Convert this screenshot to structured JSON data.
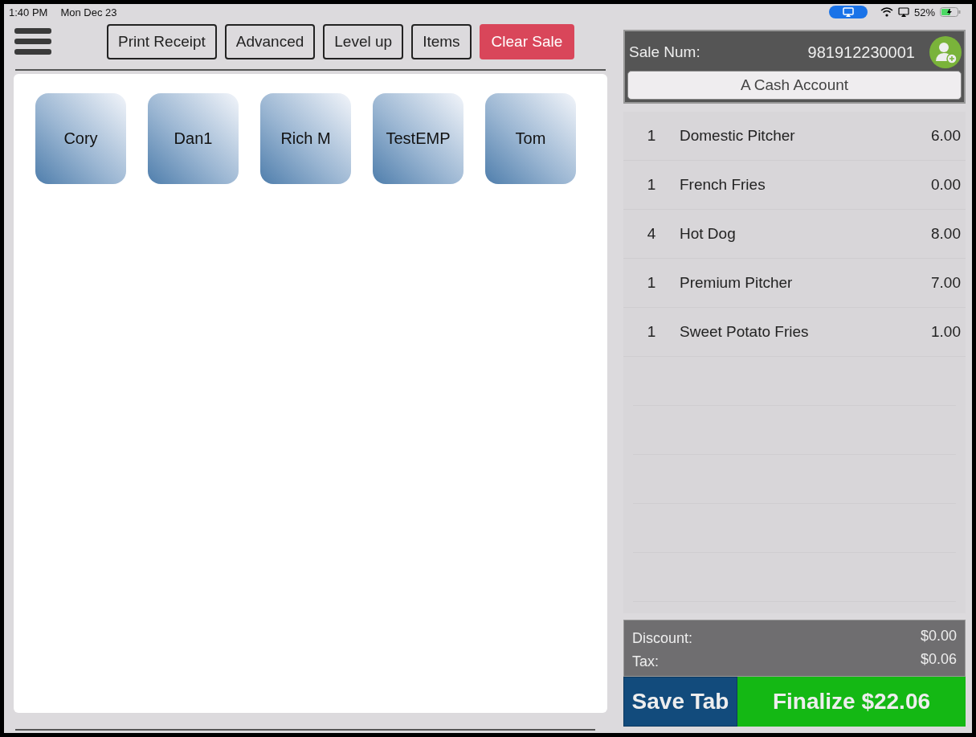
{
  "status_bar": {
    "time": "1:40 PM",
    "date": "Mon Dec 23",
    "battery": "52%"
  },
  "toolbar": {
    "buttons": [
      {
        "label": "Print Receipt",
        "kind": "outline"
      },
      {
        "label": "Advanced",
        "kind": "outline"
      },
      {
        "label": "Level up",
        "kind": "outline"
      },
      {
        "label": "Items",
        "kind": "outline"
      },
      {
        "label": "Clear Sale",
        "kind": "danger"
      }
    ]
  },
  "employees": [
    "Cory",
    "Dan1",
    "Rich M",
    "TestEMP",
    "Tom"
  ],
  "sale": {
    "label": "Sale Num:",
    "number": "981912230001",
    "account": "A Cash Account"
  },
  "line_items": [
    {
      "qty": "1",
      "name": "Domestic Pitcher",
      "price": "6.00"
    },
    {
      "qty": "1",
      "name": "French Fries",
      "price": "0.00"
    },
    {
      "qty": "4",
      "name": "Hot Dog",
      "price": "8.00"
    },
    {
      "qty": "1",
      "name": "Premium Pitcher",
      "price": "7.00"
    },
    {
      "qty": "1",
      "name": "Sweet Potato Fries",
      "price": "1.00"
    }
  ],
  "totals": [
    {
      "label": "Discount:",
      "value": "$0.00"
    },
    {
      "label": "Tax:",
      "value": "$0.06"
    }
  ],
  "actions": {
    "save": "Save Tab",
    "finalize": "Finalize $22.06"
  }
}
